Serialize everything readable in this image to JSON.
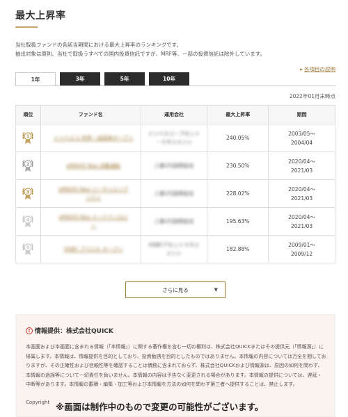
{
  "header": {
    "title": "最大上昇率",
    "description_lines": [
      "当社取扱ファンドの各該当期間における最大上昇率のランキングです。",
      "抽出対象は原則、当社で取扱うすべての国内投資信託ですが、MRF等、一部の投資信託は除外しています。"
    ],
    "explain_link": "各項目の説明"
  },
  "tabs": [
    {
      "label": "1年",
      "active": true
    },
    {
      "label": "3年",
      "active": false
    },
    {
      "label": "5年",
      "active": false
    },
    {
      "label": "10年",
      "active": false
    }
  ],
  "date_note": "2022年01月末時点",
  "table": {
    "headers": [
      "順位",
      "ファンド名",
      "運用会社",
      "最大上昇率",
      "期間"
    ],
    "rows": [
      {
        "rank": "1",
        "medal_color": "#b8964c",
        "fund_lines": [
          "インベスコ 世界・成長株オープン"
        ],
        "company_lines": [
          "インベスコ・アセット",
          "・マネジメント"
        ],
        "rate": "240.05%",
        "period_start": "2003/05～",
        "period_end": "2004/04"
      },
      {
        "rank": "2",
        "medal_color": "#9a9a9a",
        "fund_lines": [
          "eMAXIS Neo 自動運転"
        ],
        "company_lines": [
          "三菱UFJ国際投信"
        ],
        "rate": "230.50%",
        "period_start": "2020/04～",
        "period_end": "2021/03"
      },
      {
        "rank": "3",
        "medal_color": "#b8964c",
        "fund_lines": [
          "eMAXIS Neo バーチャルリア",
          "リティ"
        ],
        "company_lines": [
          "三菱UFJ国際投信"
        ],
        "rate": "228.02%",
        "period_start": "2020/04～",
        "period_end": "2021/03"
      },
      {
        "rank": "4",
        "medal_color": "#c4c4c4",
        "fund_lines": [
          "eMAXIS Neo ナノテクノロジ",
          "ー"
        ],
        "company_lines": [
          "三菱UFJ国際投信"
        ],
        "rate": "195.63%",
        "period_start": "2020/04～",
        "period_end": "2021/03"
      },
      {
        "rank": "5",
        "medal_color": "#c4c4c4",
        "fund_lines": [
          "HSBC ブラジル オープン"
        ],
        "company_lines": [
          "HSBCアセットマネジ",
          "メント"
        ],
        "rate": "182.88%",
        "period_start": "2009/01～",
        "period_end": "2009/12"
      }
    ]
  },
  "more_button": "さらに見る",
  "info": {
    "title": "情報提供：株式会社QUICK",
    "body": "本画面および本画面に含まれる情報（「本情報」）に関する著作権を含む一切の権利は、株式会社QUICKまたはその提供元（「情報源」）に帰属します。本情報は、情報提供を目的としており、投資勧誘を目的としたものではありません。本情報の内容については万全を期しておりますが、その正確性および信頼性等を確認することは債務に含まれておらず、株式会社QUICKおよび情報源は、原因の如何を問わず、本情報の過誤等について一切責任を負いません。本情報の内容は予告なく変更される場合があります。本情報の提供については、遅延・中断等があります。本情報の蓄積・編集・加工等および本情報を方法の如何を問わず第三者へ提供することは、禁止します。",
    "copyright": "Copyright"
  },
  "notice": "※画面は制作中のもので変更の可能性がございます。"
}
